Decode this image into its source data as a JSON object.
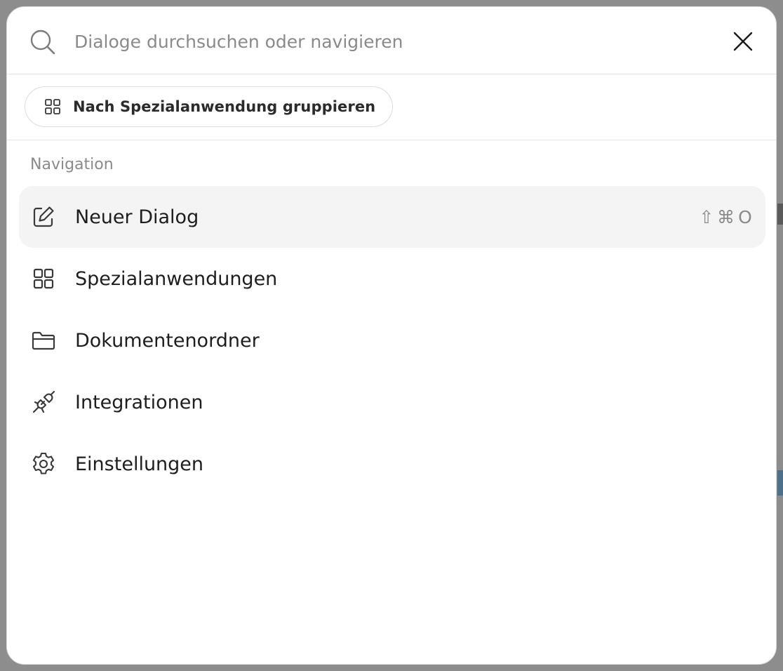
{
  "search": {
    "placeholder": "Dialoge durchsuchen oder navigieren",
    "value": ""
  },
  "filter": {
    "group_label": "Nach Spezialanwendung gruppieren"
  },
  "navigation": {
    "heading": "Navigation",
    "items": [
      {
        "label": "Neuer Dialog",
        "icon": "edit-icon",
        "active": true,
        "shortcut": [
          "⇧",
          "⌘",
          "O"
        ]
      },
      {
        "label": "Spezialanwendungen",
        "icon": "grid-icon"
      },
      {
        "label": "Dokumentenordner",
        "icon": "folder-icon"
      },
      {
        "label": "Integrationen",
        "icon": "plug-icon"
      },
      {
        "label": "Einstellungen",
        "icon": "gear-icon"
      }
    ]
  },
  "colors": {
    "overlay": "#8d8d8d",
    "surface": "#ffffff",
    "active_item": "#f4f4f4",
    "muted_text": "#8a8a8a",
    "primary_text": "#1e1e1e"
  }
}
